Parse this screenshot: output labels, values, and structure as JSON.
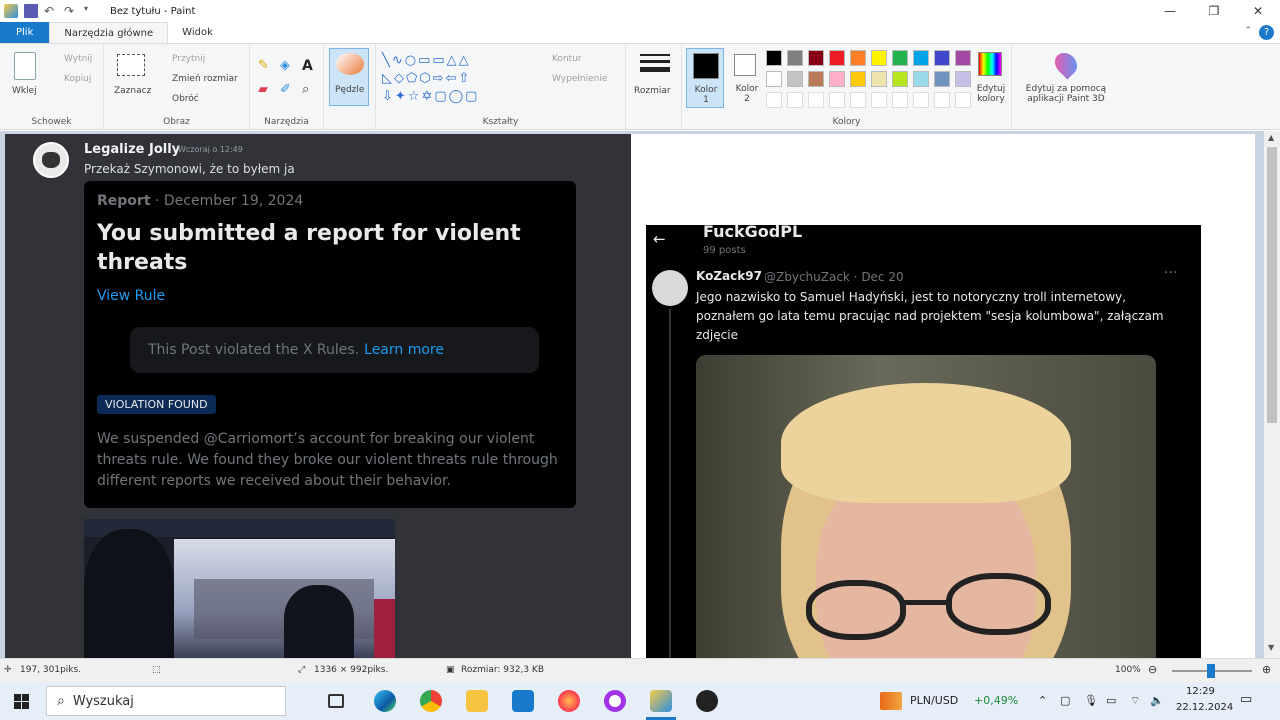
{
  "window": {
    "title": "Bez tytułu - Paint"
  },
  "tabs": [
    {
      "label": "Plik"
    },
    {
      "label": "Narzędzia główne"
    },
    {
      "label": "Widok"
    }
  ],
  "ribbon": {
    "clipboard": {
      "paste": "Wklej",
      "cut": "Wytnij",
      "copy": "Kopiuj",
      "label": "Schowek"
    },
    "image": {
      "select": "Zaznacz",
      "crop": "Przytnij",
      "resize": "Zmień rozmiar",
      "rotate": "Obróć",
      "label": "Obraz"
    },
    "tools": {
      "label": "Narzędzia",
      "text": "A"
    },
    "brushes": {
      "label": "Pędzle"
    },
    "shapes": {
      "outline": "Kontur",
      "fill": "Wypełnienie",
      "label": "Kształty"
    },
    "size": {
      "label": "Rozmiar"
    },
    "colors": {
      "color1": "Kolor 1",
      "color2": "Kolor 2",
      "edit": "Edytuj kolory",
      "label": "Kolory",
      "palette_row1": [
        "#000000",
        "#7f7f7f",
        "#880015",
        "#ed1c24",
        "#ff7f27",
        "#fff200",
        "#22b14c",
        "#00a2e8",
        "#3f48cc",
        "#a349a4"
      ],
      "palette_row2": [
        "#ffffff",
        "#c3c3c3",
        "#b97a57",
        "#ffaec9",
        "#ffc90e",
        "#efe4b0",
        "#b5e61d",
        "#99d9ea",
        "#7092be",
        "#c8bfe7"
      ]
    },
    "paint3d": {
      "label": "Edytuj za pomocą aplikacji Paint 3D"
    }
  },
  "discord": {
    "author": "Legalize Jolly",
    "time": "Wczoraj o 12:49",
    "message": "Przekaż Szymonowi, że to byłem ja",
    "card": {
      "subtitle_bold": "Report",
      "subtitle_date": "· December 19, 2024",
      "title": "You submitted a report for violent threats",
      "view_rule": "View Rule",
      "box_text": "This Post violated the X Rules.",
      "learn_more": "Learn more",
      "badge": "VIOLATION FOUND",
      "paragraph": "We suspended @Carriomort’s account for breaking our violent threats rule. We found they broke our violent threats rule through different reports we received about their behavior."
    }
  },
  "twitter": {
    "back": "←",
    "profile_name": "FuckGodPL",
    "posts": "99 posts",
    "author": "KoZack97",
    "handle": "@ZbychuZack · Dec 20",
    "more": "···",
    "text": "Jego nazwisko to Samuel Hadyński, jest to notoryczny troll internetowy, poznałem go lata temu pracując nad projektem \"sesja kolumbowa\", załączam zdjęcie"
  },
  "status": {
    "cursor": "197, 301piks.",
    "dimensions": "1336 × 992piks.",
    "filesize": "Rozmiar: 932,3 KB",
    "zoom": "100%"
  },
  "taskbar": {
    "search_placeholder": "Wyszukaj",
    "ticker": "PLN/USD",
    "ticker_change": "+0,49%",
    "clock_time": "12:29",
    "clock_date": "22.12.2024"
  }
}
